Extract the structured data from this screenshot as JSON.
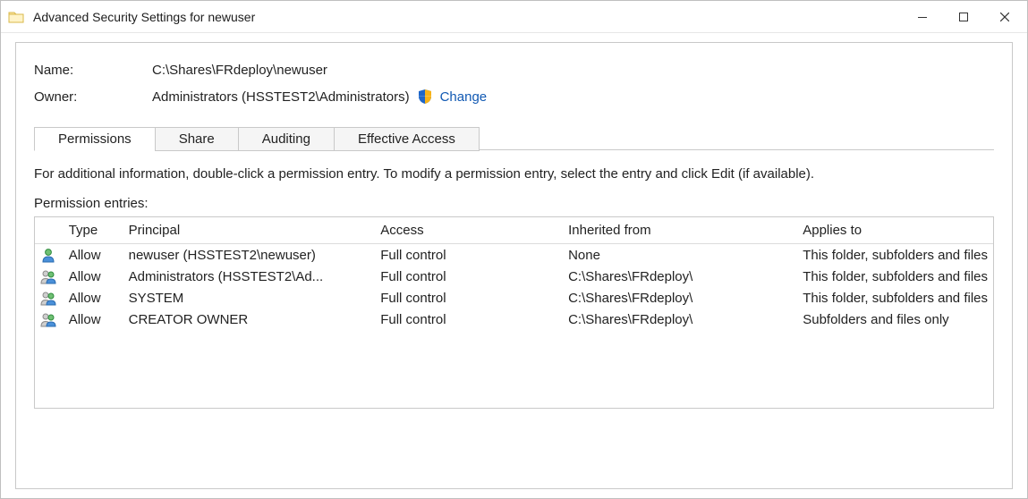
{
  "window": {
    "title": "Advanced Security Settings for newuser"
  },
  "header": {
    "name_label": "Name:",
    "name_value": "C:\\Shares\\FRdeploy\\newuser",
    "owner_label": "Owner:",
    "owner_value": "Administrators (HSSTEST2\\Administrators)",
    "change_text": "Change"
  },
  "tabs": [
    {
      "label": "Permissions",
      "active": true
    },
    {
      "label": "Share",
      "active": false
    },
    {
      "label": "Auditing",
      "active": false
    },
    {
      "label": "Effective Access",
      "active": false
    }
  ],
  "hint_text": "For additional information, double-click a permission entry. To modify a permission entry, select the entry and click Edit (if available).",
  "entries_label": "Permission entries:",
  "columns": {
    "type": "Type",
    "principal": "Principal",
    "access": "Access",
    "inherited": "Inherited from",
    "applies": "Applies to"
  },
  "rows": [
    {
      "icon": "single",
      "type": "Allow",
      "principal": "newuser (HSSTEST2\\newuser)",
      "access": "Full control",
      "inherited": "None",
      "applies": "This folder, subfolders and files"
    },
    {
      "icon": "group",
      "type": "Allow",
      "principal": "Administrators (HSSTEST2\\Ad...",
      "access": "Full control",
      "inherited": "C:\\Shares\\FRdeploy\\",
      "applies": "This folder, subfolders and files"
    },
    {
      "icon": "group",
      "type": "Allow",
      "principal": "SYSTEM",
      "access": "Full control",
      "inherited": "C:\\Shares\\FRdeploy\\",
      "applies": "This folder, subfolders and files"
    },
    {
      "icon": "group",
      "type": "Allow",
      "principal": "CREATOR OWNER",
      "access": "Full control",
      "inherited": "C:\\Shares\\FRdeploy\\",
      "applies": "Subfolders and files only"
    }
  ]
}
